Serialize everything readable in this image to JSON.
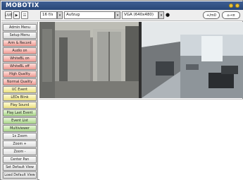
{
  "brand": {
    "logo_text": "MOBOTIX",
    "accent": "#2b4a7a",
    "status_dot_color": "#e8c23a"
  },
  "toolbar": {
    "btn_one": "LIVE",
    "btn_two": "▶",
    "btn_three": "☷",
    "framerate": "16 f/s",
    "camera": "Aufzug",
    "resolution": "VGA (640x480)",
    "info_icon": "●",
    "btn_right_one": "+/m0",
    "btn_right_two": "⌂→≡"
  },
  "sidebar": {
    "items": [
      {
        "label": "Admin Menu",
        "style": "plain"
      },
      {
        "label": "Setup Menu",
        "style": "plain"
      },
      {
        "label": "Arm & Record",
        "style": "red"
      },
      {
        "label": "Audio on",
        "style": "red"
      },
      {
        "label": "WhiteBL on",
        "style": "red"
      },
      {
        "label": "WhiteBL off",
        "style": "red"
      },
      {
        "label": "High Quality",
        "style": "red"
      },
      {
        "label": "Normal Quality",
        "style": "red"
      },
      {
        "label": "UC Event",
        "style": "yellow"
      },
      {
        "label": "LEDs Blink",
        "style": "yellow"
      },
      {
        "label": "Play Sound",
        "style": "yellow"
      },
      {
        "label": "Play Last Event",
        "style": "green"
      },
      {
        "label": "Event List",
        "style": "green"
      },
      {
        "label": "Multiviewer",
        "style": "green"
      },
      {
        "label": "1x Zoom",
        "style": "plain"
      },
      {
        "label": "Zoom +",
        "style": "plain"
      },
      {
        "label": "Zoom -",
        "style": "plain"
      },
      {
        "label": "Center Pan",
        "style": "plain"
      },
      {
        "label": "Set Default View",
        "style": "plain"
      },
      {
        "label": "Load Default View",
        "style": "plain"
      }
    ]
  }
}
